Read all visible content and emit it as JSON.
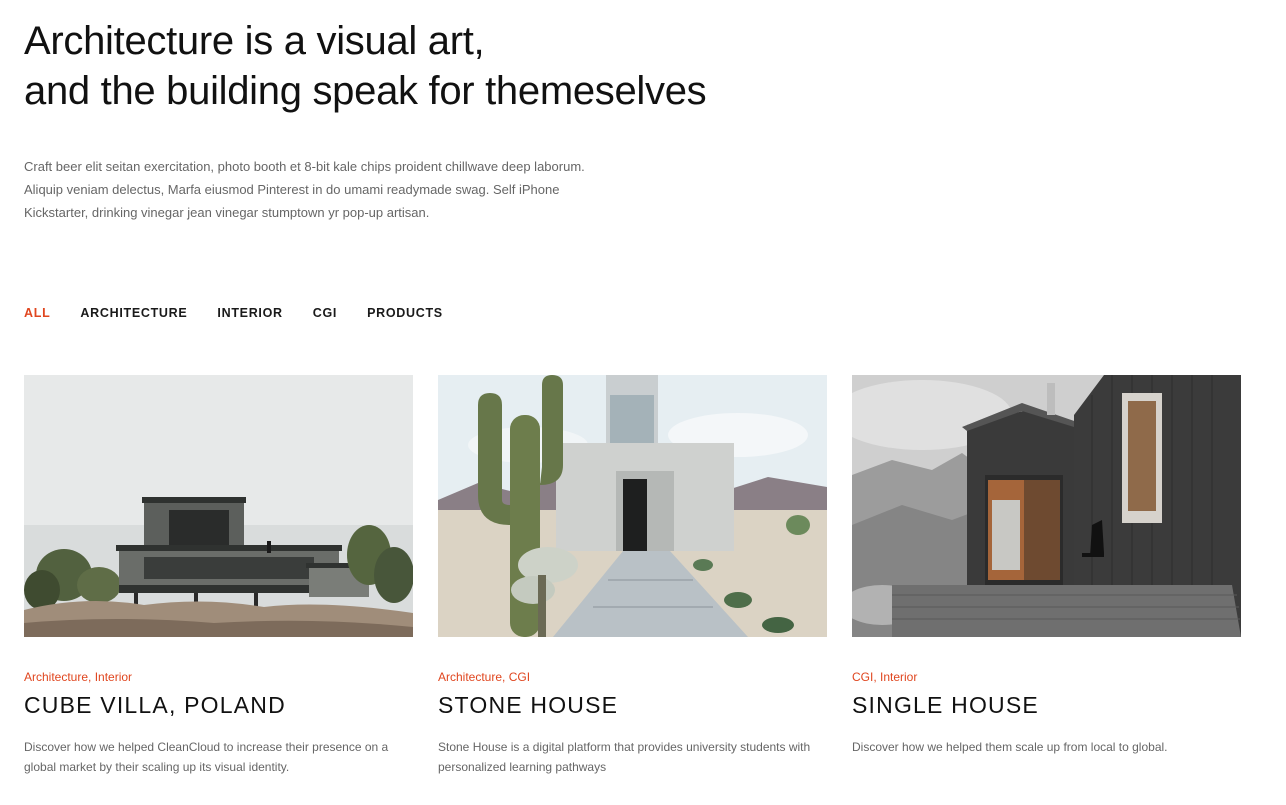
{
  "hero": {
    "title_line1": "Architecture is a visual art,",
    "title_line2": "and the building speak for themeselves",
    "intro_line1": "Craft beer elit seitan exercitation, photo booth et 8-bit kale chips proident chillwave deep laborum.",
    "intro_line2": "Aliquip veniam delectus, Marfa eiusmod Pinterest in do umami readymade swag. Self iPhone",
    "intro_line3": "Kickstarter, drinking vinegar jean vinegar stumptown yr pop-up artisan."
  },
  "filters": [
    {
      "label": "ALL",
      "active": true
    },
    {
      "label": "ARCHITECTURE",
      "active": false
    },
    {
      "label": "INTERIOR",
      "active": false
    },
    {
      "label": "CGI",
      "active": false
    },
    {
      "label": "PRODUCTS",
      "active": false
    }
  ],
  "projects": [
    {
      "categories": "Architecture, Interior",
      "title": "CUBE VILLA, POLAND",
      "description": "Discover how we helped CleanCloud to increase their presence on a global market by their scaling up its visual identity."
    },
    {
      "categories": "Architecture, CGI",
      "title": "STONE HOUSE",
      "description": "Stone House is a digital platform that provides university students with personalized learning pathways"
    },
    {
      "categories": "CGI, Interior",
      "title": "SINGLE HOUSE",
      "description": "Discover how we helped them scale up from local to global."
    }
  ],
  "colors": {
    "accent": "#e0461f",
    "text": "#111111",
    "muted": "#666666"
  }
}
